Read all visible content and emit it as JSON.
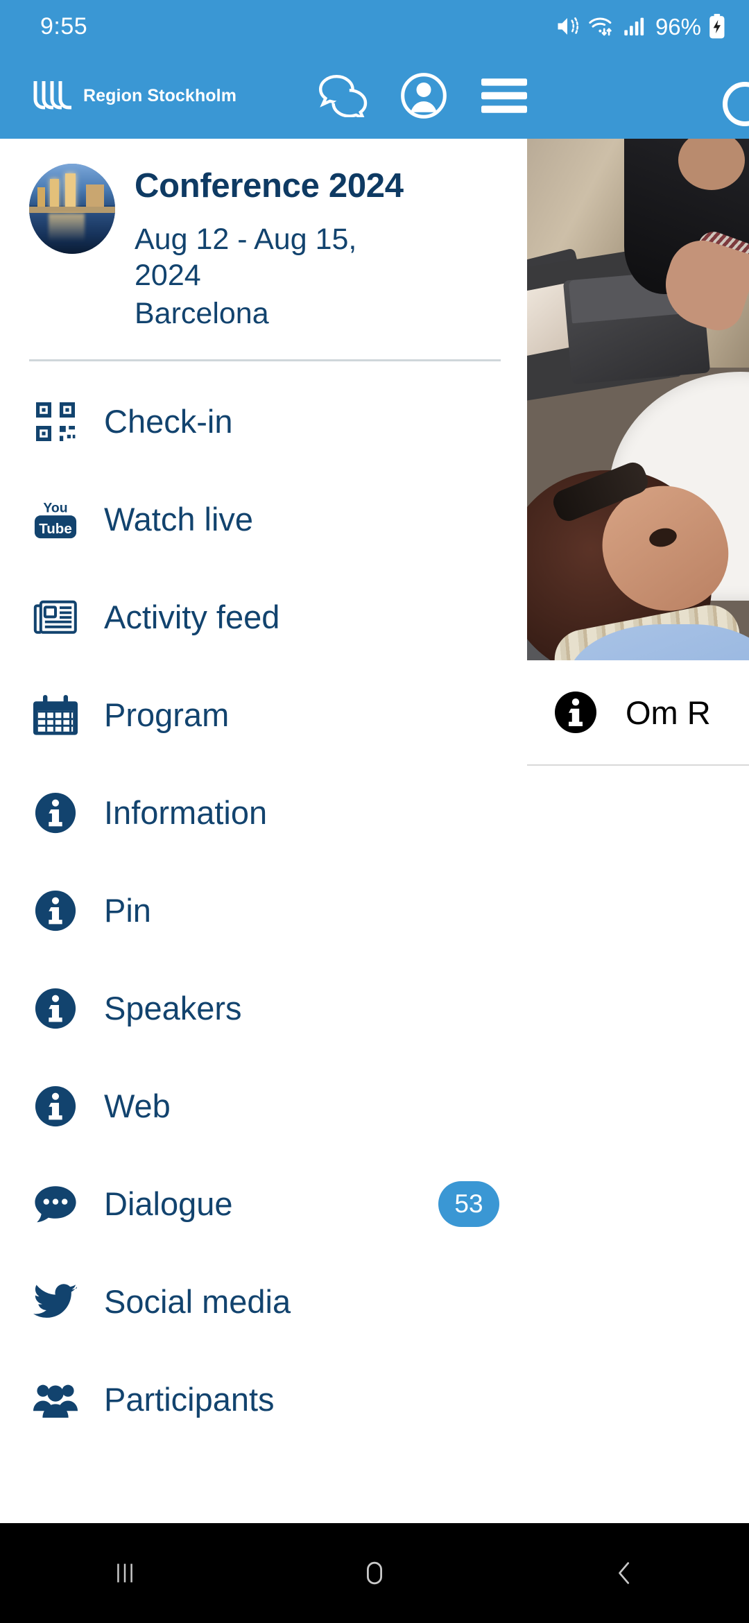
{
  "status_bar": {
    "time": "9:55",
    "battery_percent": "96%",
    "icons": [
      "mute-icon",
      "wifi-icon",
      "cellular-signal-icon",
      "battery-charging-icon"
    ]
  },
  "app_header": {
    "brand_name": "Region Stockholm",
    "brand_logo": "region-stockholm-logo",
    "actions": [
      {
        "name": "chat-icon",
        "label": "Chat"
      },
      {
        "name": "profile-icon",
        "label": "Profile"
      },
      {
        "name": "hamburger-menu-icon",
        "label": "Menu"
      }
    ]
  },
  "drawer": {
    "conference": {
      "title": "Conference 2024",
      "dates": "Aug 12 - Aug 15, 2024",
      "city": "Barcelona",
      "avatar": "conference-city-photo"
    },
    "menu_items": [
      {
        "label": "Check-in",
        "icon": "qr-code-icon",
        "badge": ""
      },
      {
        "label": "Watch live",
        "icon": "youtube-icon",
        "badge": ""
      },
      {
        "label": "Activity feed",
        "icon": "newspaper-icon",
        "badge": ""
      },
      {
        "label": "Program",
        "icon": "calendar-icon",
        "badge": ""
      },
      {
        "label": "Information",
        "icon": "info-circle-icon",
        "badge": ""
      },
      {
        "label": "Pin",
        "icon": "info-circle-icon",
        "badge": ""
      },
      {
        "label": "Speakers",
        "icon": "info-circle-icon",
        "badge": ""
      },
      {
        "label": "Web",
        "icon": "info-circle-icon",
        "badge": ""
      },
      {
        "label": "Dialogue",
        "icon": "chat-bubble-icon",
        "badge": "53"
      },
      {
        "label": "Social media",
        "icon": "twitter-bird-icon",
        "badge": ""
      },
      {
        "label": "Participants",
        "icon": "people-group-icon",
        "badge": ""
      }
    ]
  },
  "background_page": {
    "hero_image": "event-attendees-photo",
    "row_label": "Om R",
    "row_icon": "info-circle-black-icon"
  },
  "nav_bar": {
    "buttons": [
      {
        "name": "recents-button",
        "icon": "recents-icon"
      },
      {
        "name": "home-button",
        "icon": "home-icon"
      },
      {
        "name": "back-button",
        "icon": "back-chevron-icon"
      }
    ]
  },
  "colors": {
    "header_blue": "#3a97d4",
    "navy_text": "#12436e",
    "title_navy": "#0e3a63",
    "badge_blue": "#3a97d4",
    "nav_bar_black": "#000000",
    "divider_grey": "#cfd6da"
  }
}
